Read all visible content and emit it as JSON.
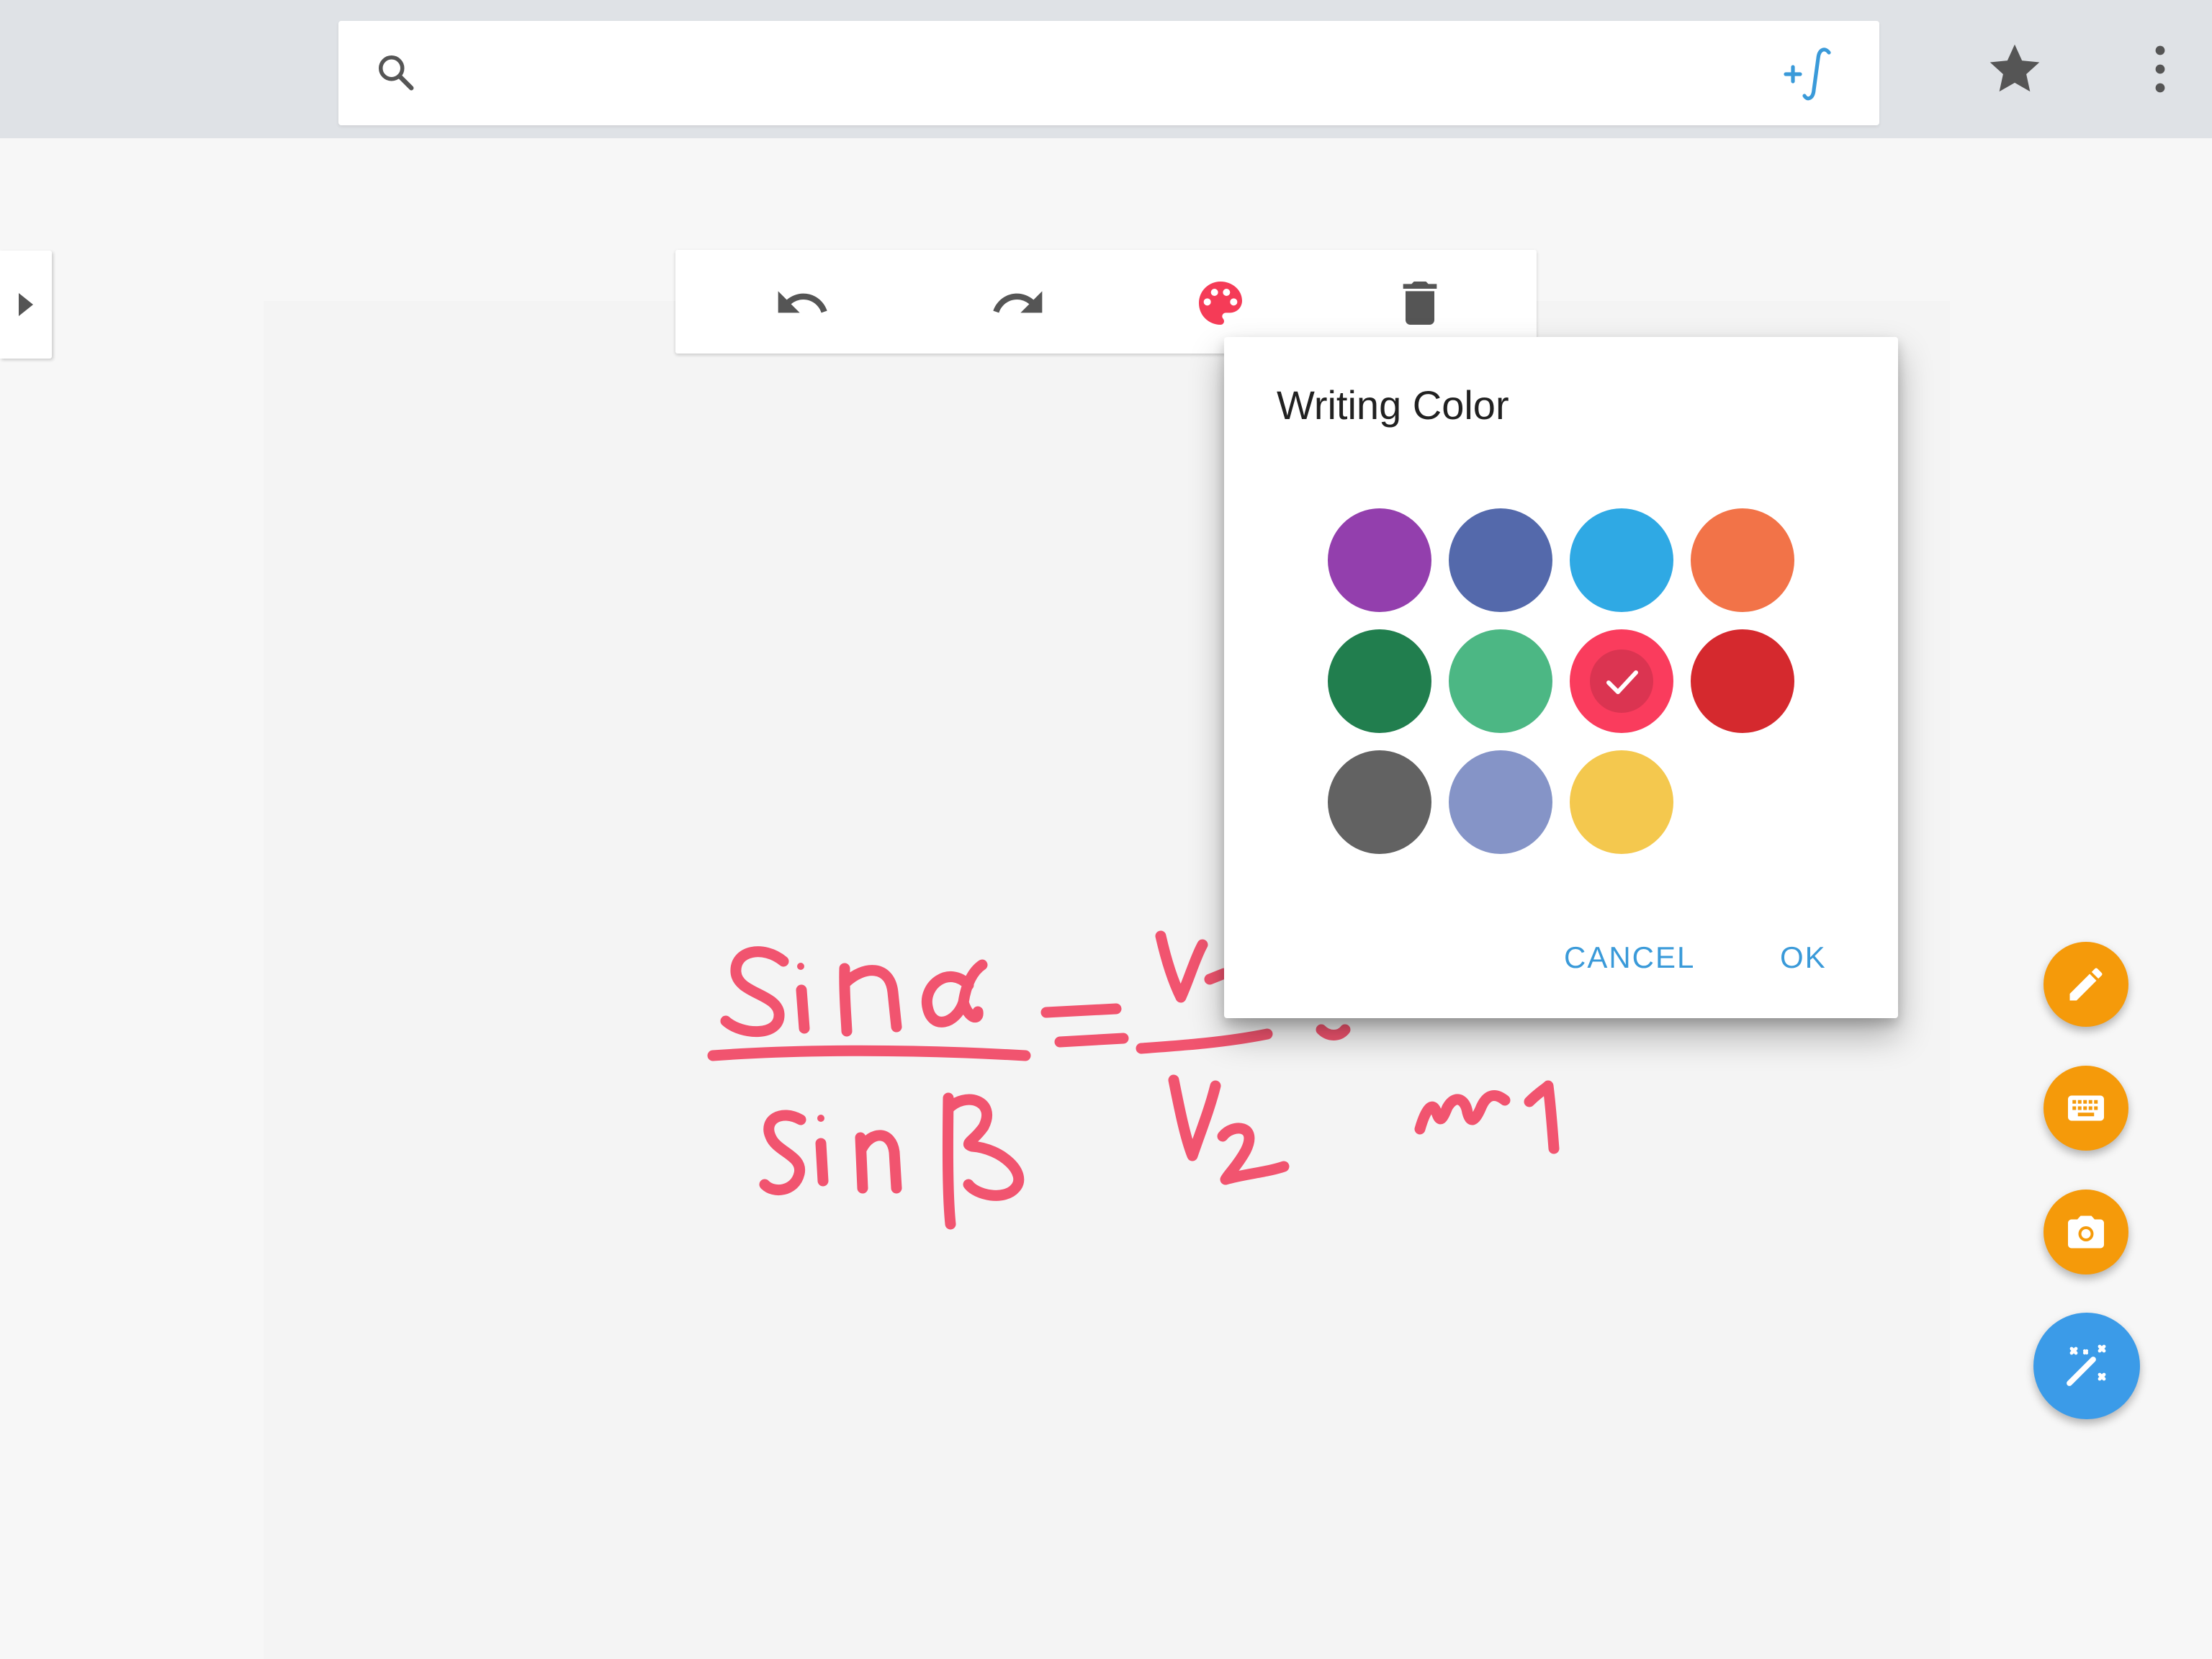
{
  "search": {
    "value": "",
    "placeholder": ""
  },
  "icons": {
    "search": "search-icon",
    "add_formula": "integral-plus-icon",
    "star": "star-icon",
    "more": "more-vert-icon",
    "expand": "chevron-right-icon",
    "undo": "undo-icon",
    "redo": "redo-icon",
    "palette": "palette-icon",
    "delete": "trash-icon",
    "pen": "pencil-icon",
    "keyboard": "keyboard-icon",
    "camera": "camera-icon",
    "magic": "magic-wand-icon"
  },
  "dialog": {
    "title": "Writing Color",
    "cancel_label": "CANCEL",
    "ok_label": "OK",
    "swatches": [
      {
        "name": "purple",
        "color": "#933fad"
      },
      {
        "name": "indigo",
        "color": "#5469ab"
      },
      {
        "name": "sky-blue",
        "color": "#2fa9e4"
      },
      {
        "name": "orange",
        "color": "#f27348"
      },
      {
        "name": "dark-green",
        "color": "#217e4e"
      },
      {
        "name": "green",
        "color": "#4cb784"
      },
      {
        "name": "pink-red",
        "color": "#fa3c5d",
        "selected": true
      },
      {
        "name": "red",
        "color": "#d5292e"
      },
      {
        "name": "dark-gray",
        "color": "#626262"
      },
      {
        "name": "lavender",
        "color": "#8594c7"
      },
      {
        "name": "yellow",
        "color": "#f4c84e"
      }
    ]
  },
  "colors": {
    "ink": "#f1546f",
    "accent_blue": "#3a9ad9",
    "fab_orange": "#f59a0a",
    "fab_blue": "#3b9be8",
    "palette_active": "#f53b57"
  }
}
